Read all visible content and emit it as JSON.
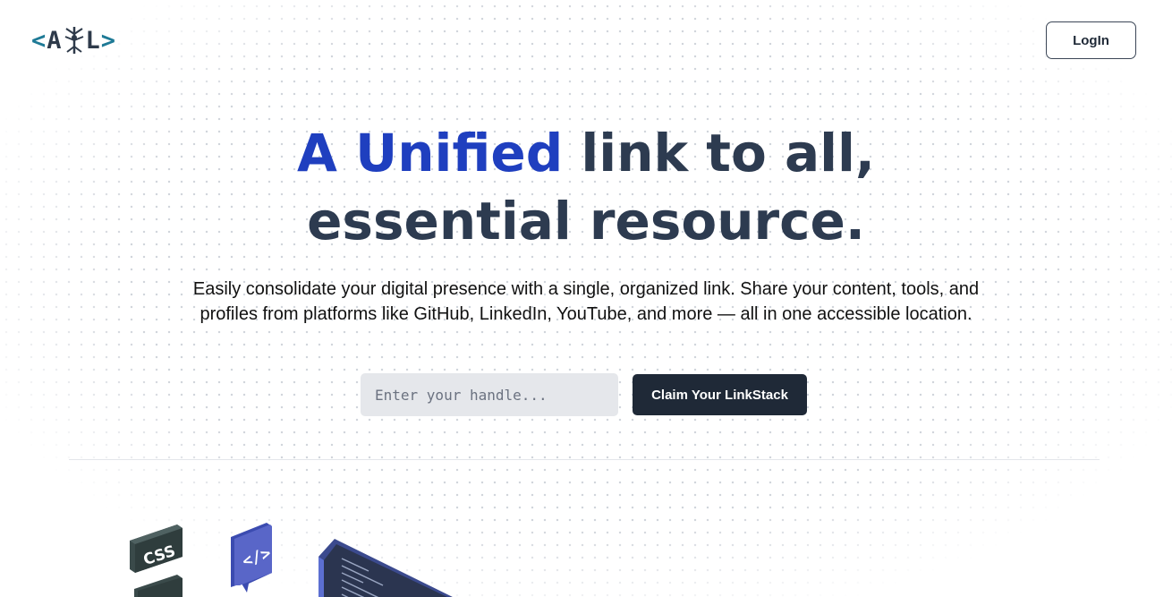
{
  "header": {
    "logo": {
      "open_bracket": "<",
      "letter_a": "A",
      "letter_l": "L",
      "close_bracket": ">",
      "mark_icon": "antenna-emblem-icon"
    },
    "login_label": "LogIn"
  },
  "hero": {
    "headline_accent": "A Unified",
    "headline_rest": " link to all,",
    "headline_line2": "essential resource.",
    "description": "Easily consolidate your digital presence with a single, organized link. Share your content, tools, and profiles from platforms like GitHub, LinkedIn, YouTube, and more — all in one accessible location.",
    "handle_placeholder": "Enter your handle...",
    "handle_value": "",
    "claim_label": "Claim Your LinkStack"
  },
  "illustrations": {
    "css_block_label": "CSS",
    "code_block_label": "</>",
    "icons": [
      "css-block-icon",
      "code-bubble-icon",
      "code-editor-window-icon"
    ]
  },
  "colors": {
    "accent_blue": "#1f3fbf",
    "heading_navy": "#2d3b50",
    "button_dark": "#1f2937",
    "logo_teal": "#1e7a96"
  }
}
